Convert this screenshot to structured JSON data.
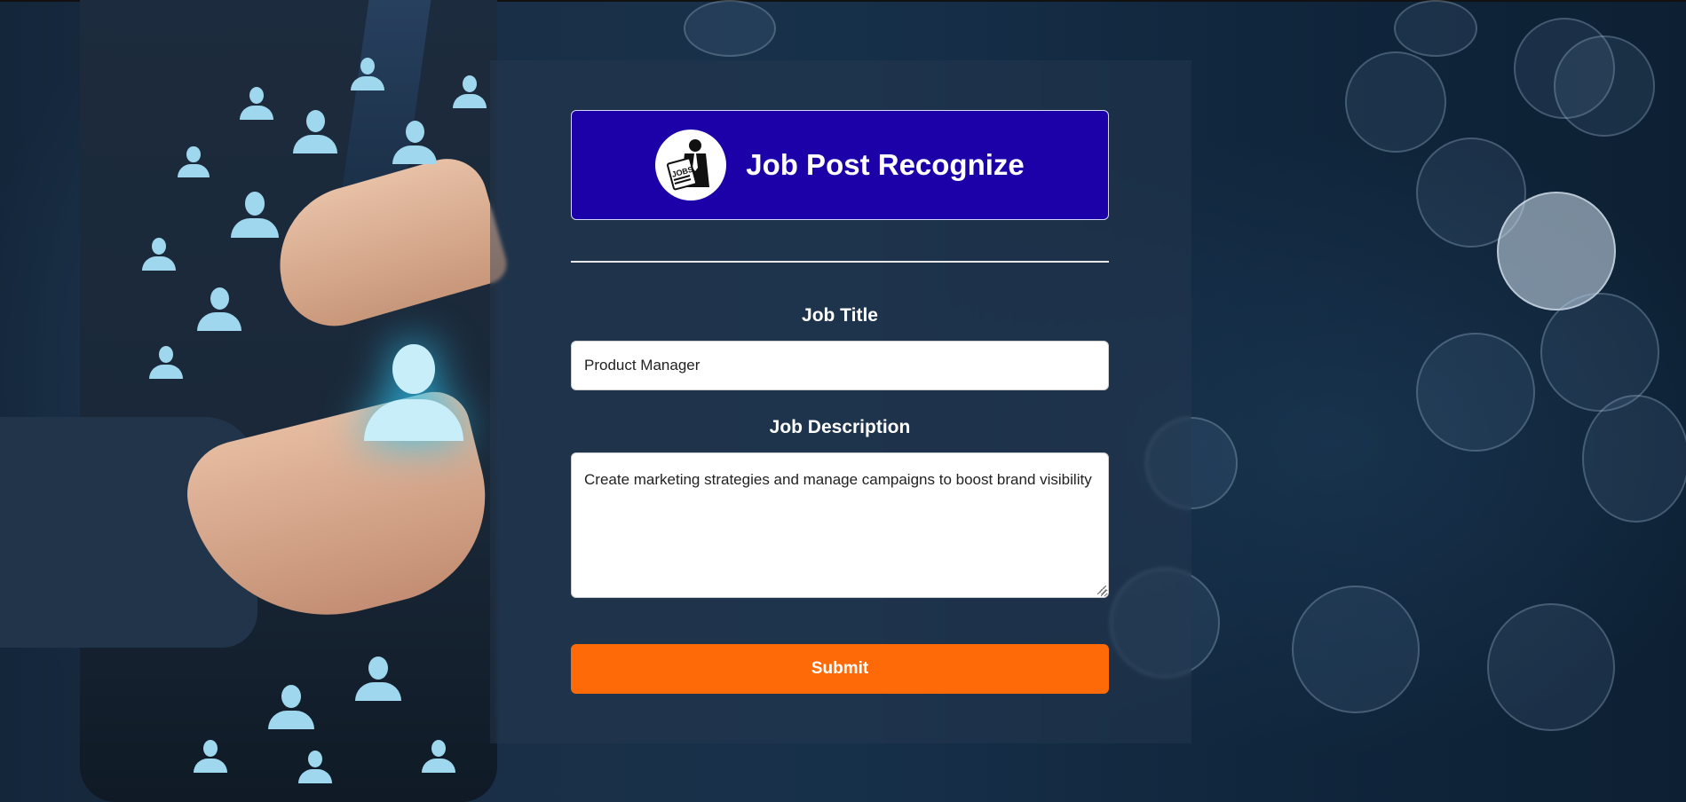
{
  "header": {
    "logo_icon": "jobs-newspaper-person-icon",
    "logo_text": "JOBS",
    "title": "Job Post Recognize"
  },
  "form": {
    "job_title": {
      "label": "Job Title",
      "value": "Product Manager"
    },
    "job_description": {
      "label": "Job Description",
      "value": "Create marketing strategies and manage campaigns to boost brand visibility"
    },
    "submit_label": "Submit"
  },
  "colors": {
    "header_bg": "#1c00a8",
    "submit_bg": "#ff6a08",
    "background": "#0f2237"
  }
}
